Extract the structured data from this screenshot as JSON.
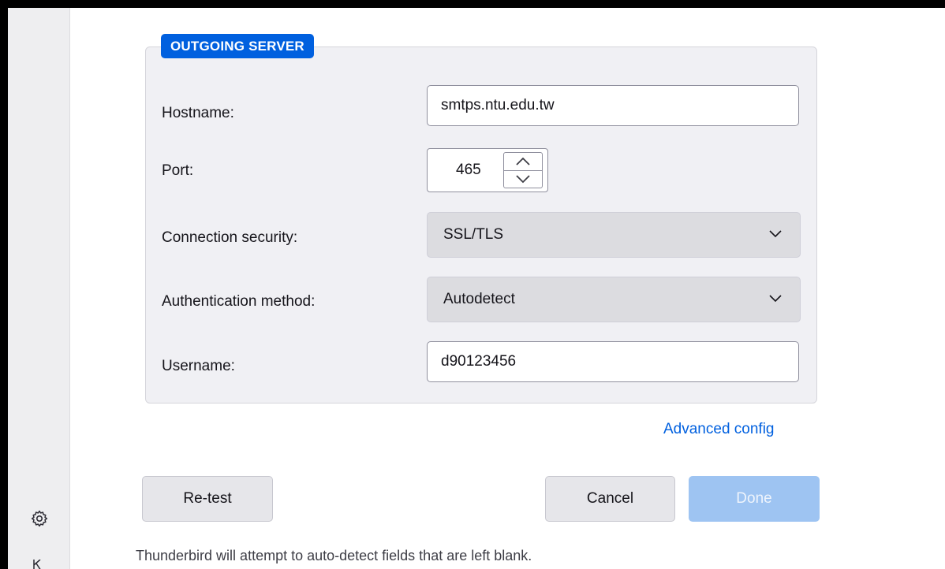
{
  "section": {
    "legend": "OUTGOING SERVER"
  },
  "fields": {
    "hostname": {
      "label": "Hostname:",
      "value": "smtps.ntu.edu.tw"
    },
    "port": {
      "label": "Port:",
      "value": "465"
    },
    "connection_security": {
      "label": "Connection security:",
      "value": "SSL/TLS"
    },
    "auth_method": {
      "label": "Authentication method:",
      "value": "Autodetect"
    },
    "username": {
      "label": "Username:",
      "value": "d90123456"
    }
  },
  "advanced_link": "Advanced config",
  "buttons": {
    "retest": "Re-test",
    "cancel": "Cancel",
    "done": "Done"
  },
  "note": "Thunderbird will attempt to auto-detect fields that are left blank.",
  "icons": {
    "sidebar_settings": "gear-icon",
    "spin_up": "chevron-up-icon",
    "spin_down": "chevron-down-icon",
    "dropdown": "chevron-down-icon"
  },
  "colors": {
    "accent": "#0060df",
    "done_disabled": "#9ec4f2",
    "fieldset_bg": "#f0f0f4"
  }
}
